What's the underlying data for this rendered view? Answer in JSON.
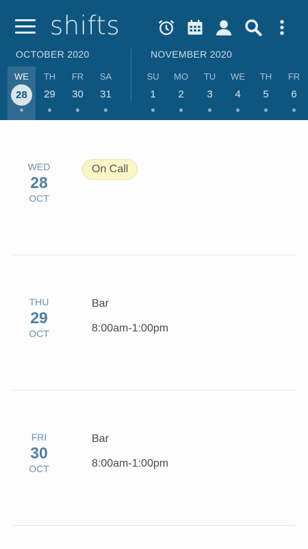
{
  "app": {
    "title": "shifts"
  },
  "toolbar": {
    "icons": [
      "alarm-icon",
      "calendar-icon",
      "person-icon",
      "search-icon",
      "more-vert-icon"
    ]
  },
  "months": [
    "OCTOBER 2020",
    "NOVEMBER 2020"
  ],
  "week_strip": [
    {
      "name": "WE",
      "num": "28",
      "selected": true
    },
    {
      "name": "TH",
      "num": "29"
    },
    {
      "name": "FR",
      "num": "30"
    },
    {
      "name": "SA",
      "num": "31"
    },
    {
      "name": "SU",
      "num": "1"
    },
    {
      "name": "MO",
      "num": "2"
    },
    {
      "name": "TU",
      "num": "3"
    },
    {
      "name": "WE",
      "num": "4"
    },
    {
      "name": "TH",
      "num": "5"
    },
    {
      "name": "FR",
      "num": "6"
    }
  ],
  "agenda": [
    {
      "weekday": "WED",
      "day": "28",
      "month": "OCT",
      "badge": "On Call"
    },
    {
      "weekday": "THU",
      "day": "29",
      "month": "OCT",
      "shift_name": "Bar",
      "shift_time": "8:00am-1:00pm"
    },
    {
      "weekday": "FRI",
      "day": "30",
      "month": "OCT",
      "shift_name": "Bar",
      "shift_time": "8:00am-1:00pm"
    }
  ],
  "colors": {
    "header": "#0e567f",
    "badge": "#fbf6c7",
    "accent": "#4f7f9c"
  }
}
